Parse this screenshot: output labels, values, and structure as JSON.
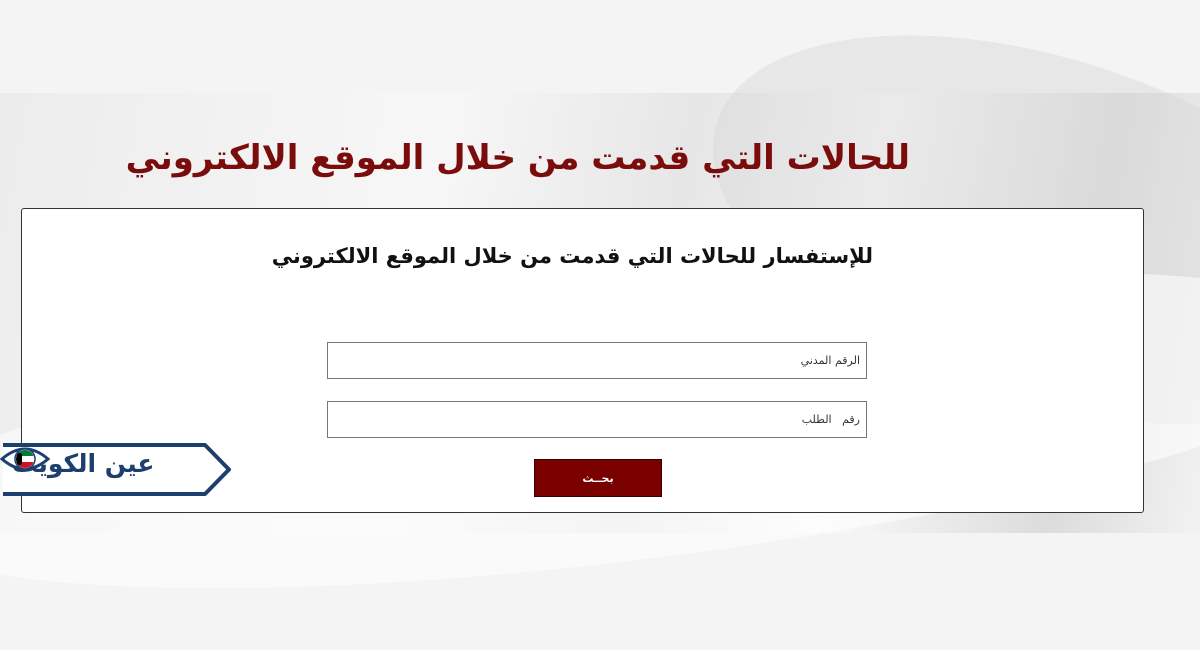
{
  "page": {
    "title": "للحالات التي قدمت من خلال الموقع الالكتروني"
  },
  "form": {
    "heading": "للإستفسار للحالات التي قدمت من خلال الموقع الالكتروني",
    "civil_id_placeholder": "الرقم المدني",
    "request_number_placeholder": "رقم   الطلب",
    "search_label": "بحــث"
  },
  "logo": {
    "text": "عين الكويت",
    "border_color": "#1d3f6e",
    "eye_colors": [
      "#007a3d",
      "#ffffff",
      "#ce1126",
      "#000000"
    ]
  },
  "colors": {
    "title": "#7a0c0c",
    "button": "#7a0000"
  }
}
